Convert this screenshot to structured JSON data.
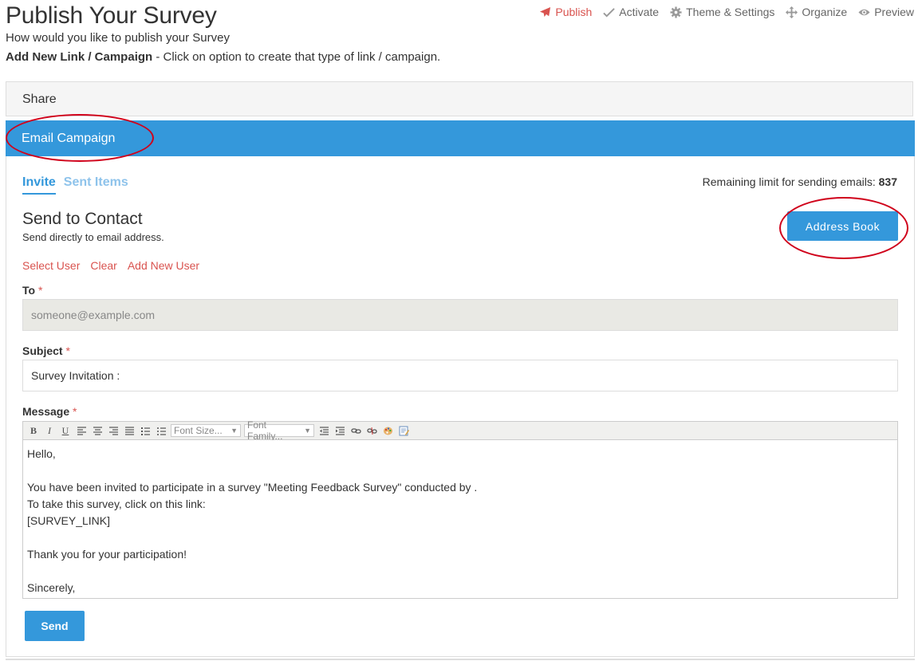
{
  "page": {
    "title": "Publish Your Survey",
    "subtitle": "How would you like to publish your Survey",
    "hint_bold": "Add New Link / Campaign",
    "hint_rest": " - Click on option to create that type of link / campaign."
  },
  "topnav": [
    {
      "label": "Publish",
      "icon": "paper-plane-icon",
      "active": true
    },
    {
      "label": "Activate",
      "icon": "check-icon",
      "active": false
    },
    {
      "label": "Theme & Settings",
      "icon": "gear-icon",
      "active": false
    },
    {
      "label": "Organize",
      "icon": "move-icon",
      "active": false
    },
    {
      "label": "Preview",
      "icon": "eye-icon",
      "active": false
    }
  ],
  "accordion": {
    "share_label": "Share",
    "email_label": "Email Campaign"
  },
  "tabs": {
    "invite": "Invite",
    "sent": "Sent Items"
  },
  "limit": {
    "label": "Remaining limit for sending emails: ",
    "value": "837"
  },
  "section": {
    "title": "Send to Contact",
    "subtitle": "Send directly to email address."
  },
  "address_book_label": "Address Book",
  "links": {
    "select_user": "Select User",
    "clear": "Clear",
    "add_new_user": "Add New User"
  },
  "form": {
    "to_label": "To",
    "to_placeholder": "someone@example.com",
    "subject_label": "Subject",
    "subject_value": "Survey Invitation :",
    "message_label": "Message",
    "required_mark": "*"
  },
  "toolbar": {
    "bold": "B",
    "italic": "I",
    "underline": "U",
    "font_size": "Font Size...",
    "font_family": "Font Family..."
  },
  "message": {
    "lines": [
      "Hello,",
      "",
      "You have been invited to participate in a survey \"Meeting Feedback Survey\" conducted by .",
      "To take this survey, click on this link:",
      "[SURVEY_LINK]",
      "",
      "Thank you for your participation!",
      "",
      "Sincerely,"
    ]
  },
  "send_label": "Send",
  "colors": {
    "primary": "#3498db",
    "danger": "#d9534f",
    "annotation": "#d0021b"
  }
}
